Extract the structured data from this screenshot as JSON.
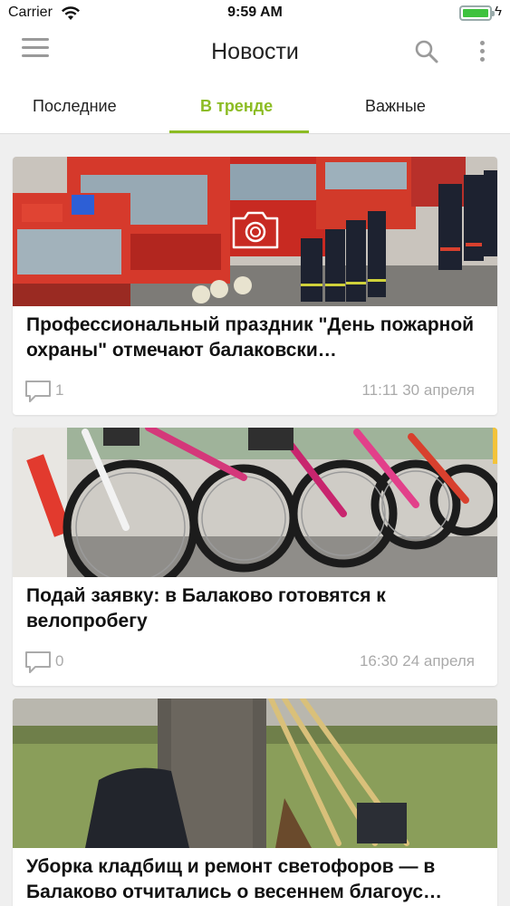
{
  "status_bar": {
    "carrier": "Carrier",
    "time": "9:59 AM",
    "battery_level": 1.0
  },
  "navbar": {
    "title": "Новости",
    "menu_icon": "hamburger-icon",
    "search_icon": "search-icon",
    "more_icon": "more-vertical-icon"
  },
  "tabs": [
    {
      "label": "Последние",
      "active": false
    },
    {
      "label": "В тренде",
      "active": true
    },
    {
      "label": "Важные",
      "active": false
    }
  ],
  "accent_color": "#8cbc24",
  "articles": [
    {
      "title": "Профессиональный праздник \"День пожарной охраны\" отмечают балаковски…",
      "comments": "1",
      "date": "11:11 30 апреля",
      "has_gallery": true
    },
    {
      "title": "Подай заявку: в Балаково готовятся к велопробегу",
      "comments": "0",
      "date": "16:30 24 апреля",
      "has_gallery": false
    },
    {
      "title": "Уборка кладбищ и ремонт светофоров — в Балаково отчитались о весеннем благоус…",
      "comments": "",
      "date": "",
      "has_gallery": false
    }
  ]
}
